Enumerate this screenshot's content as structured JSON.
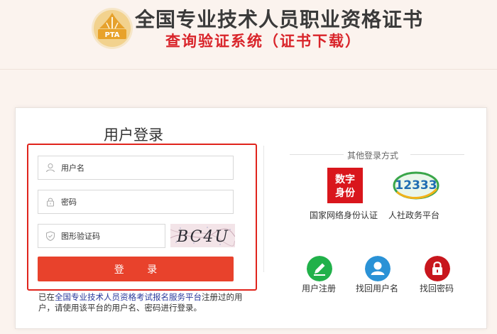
{
  "header": {
    "logo_text": "PTA",
    "title": "全国专业技术人员职业资格证书",
    "subtitle": "查询验证系统（证书下载）"
  },
  "login": {
    "title": "用户登录",
    "username_placeholder": "用户名",
    "password_placeholder": "密码",
    "captcha_placeholder": "图形验证码",
    "captcha_text": "BC4U",
    "submit_label": "登 录",
    "notice_prefix": "已在",
    "notice_link": "全国专业技术人员资格考试报名服务平台",
    "notice_suffix": "注册过的用户，请使用该平台的用户名、密码进行登录。"
  },
  "other_login": {
    "title": "其他登录方式",
    "methods": [
      {
        "badge": "数字身份",
        "label": "国家网络身份认证"
      },
      {
        "badge": "12333",
        "label": "人社政务平台"
      }
    ]
  },
  "account_actions": [
    {
      "label": "用户注册",
      "color": "#21b14a",
      "icon": "edit-icon"
    },
    {
      "label": "找回用户名",
      "color": "#2a92d6",
      "icon": "user-icon"
    },
    {
      "label": "找回密码",
      "color": "#c8161d",
      "icon": "lock-icon"
    }
  ],
  "colors": {
    "accent": "#e8422c",
    "frame": "#e0241c",
    "subtitle": "#d9242a",
    "link": "#2a3a9c"
  }
}
